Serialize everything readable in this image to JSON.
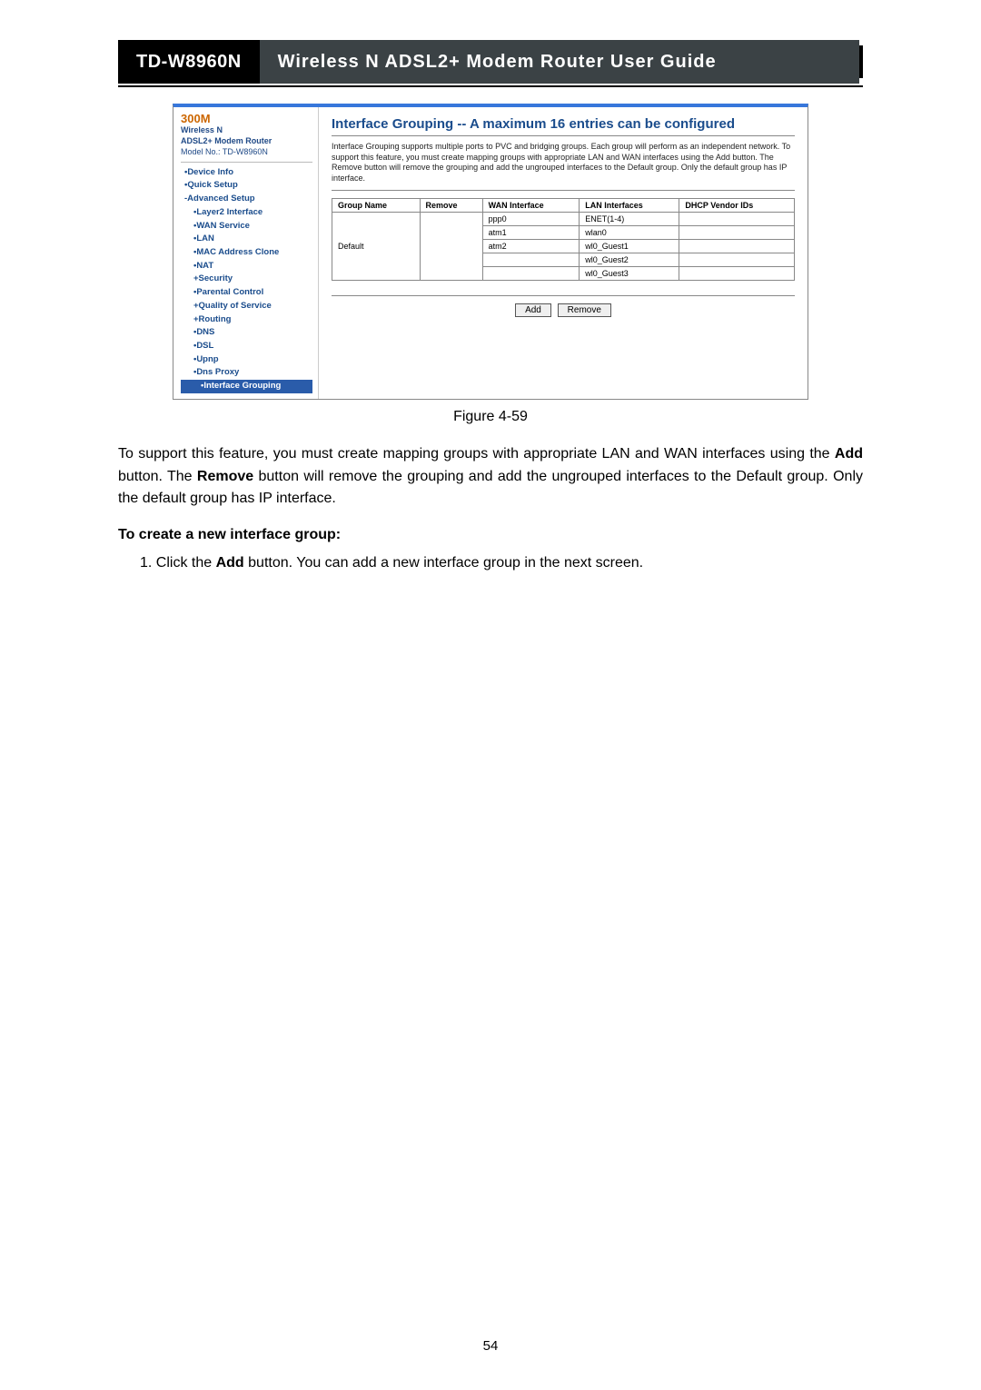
{
  "header": {
    "model": "TD-W8960N",
    "title": "Wireless  N  ADSL2+  Modem  Router  User  Guide"
  },
  "figure": {
    "brand": {
      "line1": "300M",
      "line2": "Wireless N",
      "line3": "ADSL2+ Modem Router",
      "model": "Model No.: TD-W8960N"
    },
    "nav": [
      {
        "label": "•Device Info",
        "level": 1
      },
      {
        "label": "•Quick Setup",
        "level": 1
      },
      {
        "label": "-Advanced Setup",
        "level": 1
      },
      {
        "label": "•Layer2 Interface",
        "level": 2
      },
      {
        "label": "•WAN Service",
        "level": 2
      },
      {
        "label": "•LAN",
        "level": 2
      },
      {
        "label": "•MAC Address Clone",
        "level": 2
      },
      {
        "label": "•NAT",
        "level": 2
      },
      {
        "label": "+Security",
        "level": 2
      },
      {
        "label": "•Parental Control",
        "level": 2
      },
      {
        "label": "+Quality of Service",
        "level": 2
      },
      {
        "label": "+Routing",
        "level": 2
      },
      {
        "label": "•DNS",
        "level": 2
      },
      {
        "label": "•DSL",
        "level": 2
      },
      {
        "label": "•Upnp",
        "level": 2
      },
      {
        "label": "•Dns Proxy",
        "level": 2
      },
      {
        "label": "•Interface Grouping",
        "level": 2,
        "current": true
      }
    ],
    "page_title": "Interface Grouping -- A maximum 16 entries can be configured",
    "intro": "Interface Grouping supports multiple ports to PVC and bridging groups. Each group will perform as an independent network. To support this feature, you must create mapping groups with appropriate LAN and WAN interfaces using the Add button. The Remove button will remove the grouping and add the ungrouped interfaces to the Default group. Only the default group has IP interface.",
    "table": {
      "headers": [
        "Group Name",
        "Remove",
        "WAN Interface",
        "LAN Interfaces",
        "DHCP Vendor IDs"
      ],
      "group_name": "Default",
      "rows": [
        {
          "wan": "ppp0",
          "lan": "ENET(1-4)"
        },
        {
          "wan": "atm1",
          "lan": "wlan0"
        },
        {
          "wan": "atm2",
          "lan": "wl0_Guest1"
        },
        {
          "wan": "",
          "lan": "wl0_Guest2"
        },
        {
          "wan": "",
          "lan": "wl0_Guest3"
        }
      ]
    },
    "buttons": {
      "add": "Add",
      "remove": "Remove"
    }
  },
  "caption": "Figure 4-59",
  "body": {
    "p1_a": "To support this feature, you must create mapping groups with appropriate LAN and WAN interfaces using the ",
    "p1_add": "Add",
    "p1_b": " button. The ",
    "p1_remove": "Remove",
    "p1_c": " button will remove the grouping and add the ungrouped interfaces to the Default group. Only the default group has IP interface.",
    "subhead": "To create a new interface group:",
    "step1_a": "1.   Click the ",
    "step1_add": "Add",
    "step1_b": " button. You can add a new interface group in the next screen."
  },
  "page_number": "54"
}
